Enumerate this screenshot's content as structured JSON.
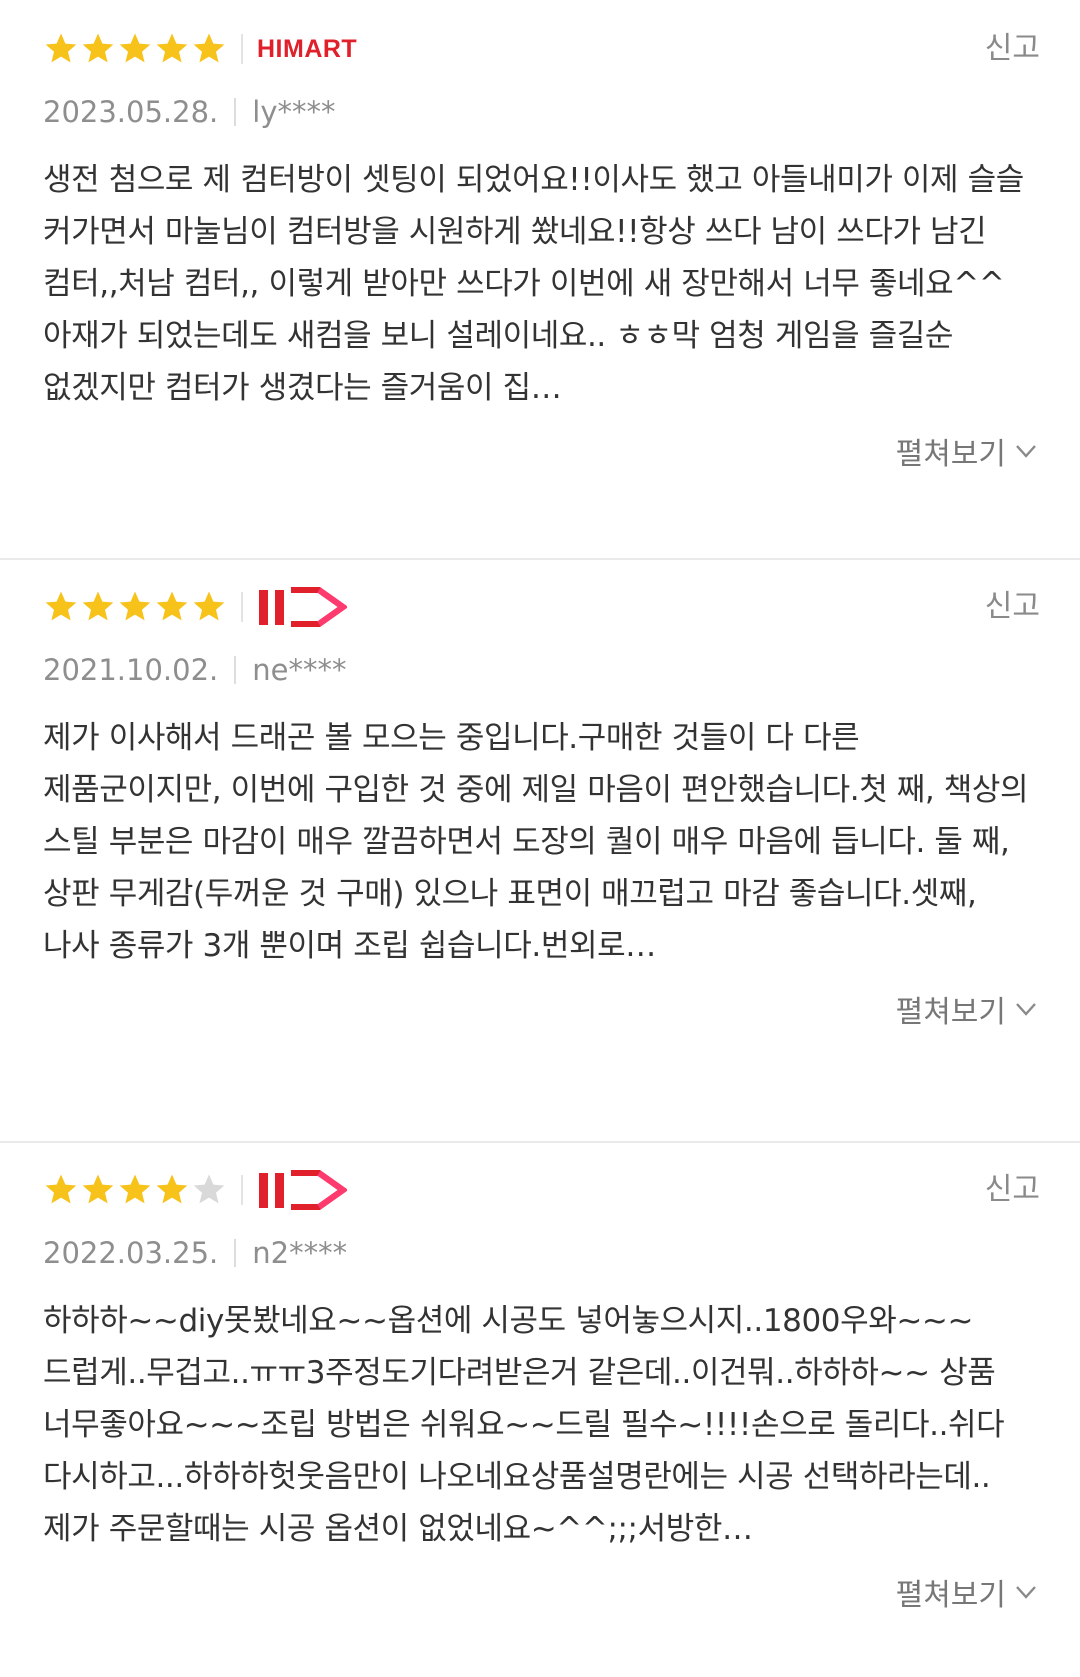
{
  "colors": {
    "star_filled": "#f7c21a",
    "star_empty": "#d9d9d9",
    "brand_red": "#e0202b",
    "gray_text": "#8e8e8e"
  },
  "reviews": [
    {
      "rating": 5,
      "seller": "HIMART",
      "seller_icon": "himart-logo",
      "report_label": "신고",
      "date": "2023.05.28.",
      "user": "ly****",
      "text": "생전 첨으로 제 컴터방이 셋팅이 되었어요!!이사도 했고 아들내미가 이제 슬슬 커가면서 마눌님이 컴터방을 시원하게 쐈네요!!항상 쓰다 남이 쓰다가 남긴 컴터,,처남 컴터,, 이렇게 받아만 쓰다가 이번에 새 장만해서 너무 좋네요^^아재가 되었는데도 새컴을 보니 설레이네요.. ㅎㅎ막 엄청 게임을 즐길순 없겠지만 컴터가 생겼다는 즐거움이 집…",
      "expand_label": "펼쳐보기"
    },
    {
      "rating": 5,
      "seller": "11번가",
      "seller_icon": "11st-logo",
      "report_label": "신고",
      "date": "2021.10.02.",
      "user": "ne****",
      "text": "제가 이사해서 드래곤 볼 모으는 중입니다.구매한 것들이 다 다른 제품군이지만, 이번에 구입한 것 중에 제일 마음이 편안했습니다.첫 째, 책상의 스틸 부분은 마감이 매우 깔끔하면서 도장의 퀄이 매우 마음에 듭니다. 둘 째, 상판 무게감(두꺼운 것 구매) 있으나 표면이 매끄럽고 마감 좋습니다.셋째, 나사 종류가 3개 뿐이며 조립 쉽습니다.번외로…",
      "expand_label": "펼쳐보기"
    },
    {
      "rating": 4,
      "seller": "11번가",
      "seller_icon": "11st-logo",
      "report_label": "신고",
      "date": "2022.03.25.",
      "user": "n2****",
      "text": "하하하~~diy못봤네요~~옵션에 시공도 넣어놓으시지..1800우와~~~ 드럽게..무겁고..ㅠㅠ3주정도기다려받은거 같은데..이건뭐..하하하~~ 상품 너무좋아요~~~조립 방법은 쉬워요~~드릴 필수~!!!!손으로 돌리다..쉬다 다시하고...하하하헛웃음만이 나오네요상품설명란에는 시공 선택하라는데..제가 주문할때는 시공 옵션이 없었네요~^^;;;서방한…",
      "expand_label": "펼쳐보기"
    }
  ]
}
